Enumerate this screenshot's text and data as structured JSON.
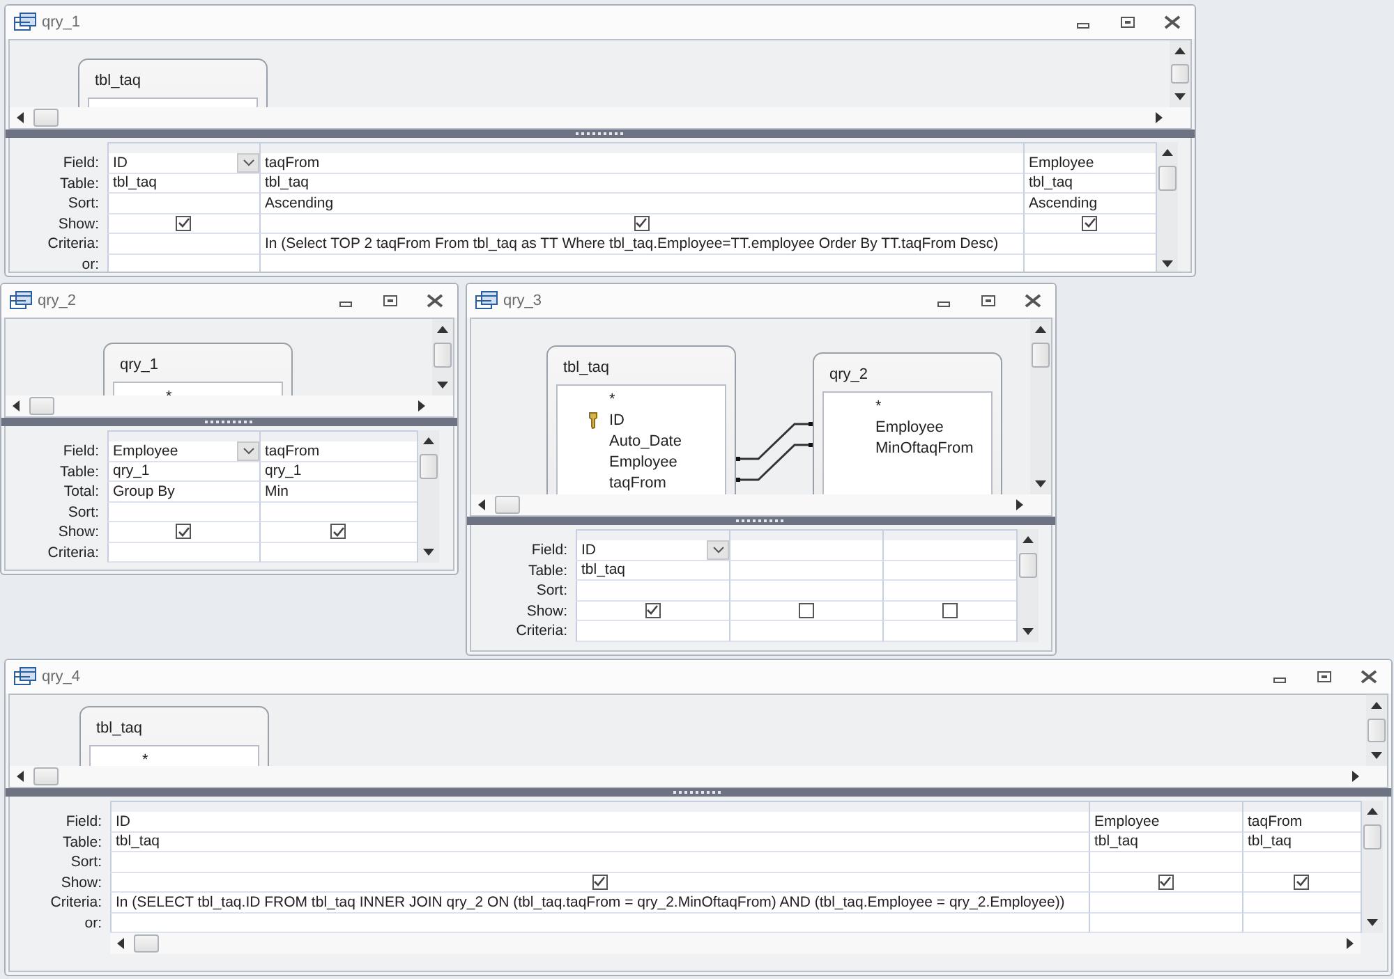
{
  "windows": [
    {
      "title": "qry_1",
      "tables": [
        {
          "name": "tbl_taq"
        }
      ],
      "rows": [
        {
          "label": "Field:",
          "kind": "field"
        },
        {
          "label": "Table:",
          "kind": "table"
        },
        {
          "label": "Sort:",
          "kind": "sort"
        },
        {
          "label": "Show:",
          "kind": "show"
        },
        {
          "label": "Criteria:",
          "kind": "criteria"
        },
        {
          "label": "or:",
          "kind": "or"
        }
      ],
      "columns": [
        {
          "field": "ID",
          "table": "tbl_taq",
          "show": true,
          "dropdown": true
        },
        {
          "field": "taqFrom",
          "table": "tbl_taq",
          "sort": "Ascending",
          "show": true,
          "dropdown": false,
          "criteria": "In (Select TOP 2 taqFrom From tbl_taq as TT Where tbl_taq.Employee=TT.employee Order By TT.taqFrom Desc)"
        },
        {
          "field": "Employee",
          "table": "tbl_taq",
          "sort": "Ascending",
          "show": true,
          "dropdown": false
        }
      ]
    },
    {
      "title": "qry_2",
      "tables": [
        {
          "name": "qry_1",
          "fields": [
            {
              "name": "*",
              "kind": "plain"
            }
          ]
        }
      ],
      "rows": [
        {
          "label": "Field:",
          "kind": "field"
        },
        {
          "label": "Table:",
          "kind": "table"
        },
        {
          "label": "Total:",
          "kind": "total"
        },
        {
          "label": "Sort:",
          "kind": "sort"
        },
        {
          "label": "Show:",
          "kind": "show"
        },
        {
          "label": "Criteria:",
          "kind": "criteria"
        }
      ],
      "columns": [
        {
          "field": "Employee",
          "table": "qry_1",
          "total": "Group By",
          "show": true,
          "dropdown": true
        },
        {
          "field": "taqFrom",
          "table": "qry_1",
          "total": "Min",
          "show": true,
          "dropdown": false
        }
      ]
    },
    {
      "title": "qry_3",
      "tables": [
        {
          "name": "tbl_taq",
          "fields": [
            {
              "name": "*",
              "kind": "plain"
            },
            {
              "name": "ID",
              "kind": "key"
            },
            {
              "name": "Auto_Date",
              "kind": "plain"
            },
            {
              "name": "Employee",
              "kind": "joined"
            },
            {
              "name": "taqFrom",
              "kind": "joined"
            }
          ]
        },
        {
          "name": "qry_2",
          "fields": [
            {
              "name": "*",
              "kind": "plain"
            },
            {
              "name": "Employee",
              "kind": "joined"
            },
            {
              "name": "MinOftaqFrom",
              "kind": "joined"
            }
          ]
        }
      ],
      "rows": [
        {
          "label": "Field:",
          "kind": "field"
        },
        {
          "label": "Table:",
          "kind": "table"
        },
        {
          "label": "Sort:",
          "kind": "sort"
        },
        {
          "label": "Show:",
          "kind": "show"
        },
        {
          "label": "Criteria:",
          "kind": "criteria"
        }
      ],
      "columns": [
        {
          "field": "ID",
          "table": "tbl_taq",
          "show": true,
          "dropdown": true
        },
        {
          "show": false,
          "dropdown": false
        },
        {
          "show": false,
          "dropdown": false
        }
      ]
    },
    {
      "title": "qry_4",
      "tables": [
        {
          "name": "tbl_taq",
          "fields": [
            {
              "name": "*",
              "kind": "plain"
            }
          ]
        }
      ],
      "rows": [
        {
          "label": "Field:",
          "kind": "field"
        },
        {
          "label": "Table:",
          "kind": "table"
        },
        {
          "label": "Sort:",
          "kind": "sort"
        },
        {
          "label": "Show:",
          "kind": "show"
        },
        {
          "label": "Criteria:",
          "kind": "criteria"
        },
        {
          "label": "or:",
          "kind": "or"
        }
      ],
      "columns": [
        {
          "field": "ID",
          "table": "tbl_taq",
          "show": true,
          "dropdown": false,
          "criteria": "In (SELECT tbl_taq.ID FROM tbl_taq INNER JOIN qry_2 ON (tbl_taq.taqFrom = qry_2.MinOftaqFrom) AND (tbl_taq.Employee = qry_2.Employee))"
        },
        {
          "field": "Employee",
          "table": "tbl_taq",
          "show": true,
          "dropdown": false
        },
        {
          "field": "taqFrom",
          "table": "tbl_taq",
          "show": true,
          "dropdown": false
        }
      ]
    }
  ]
}
